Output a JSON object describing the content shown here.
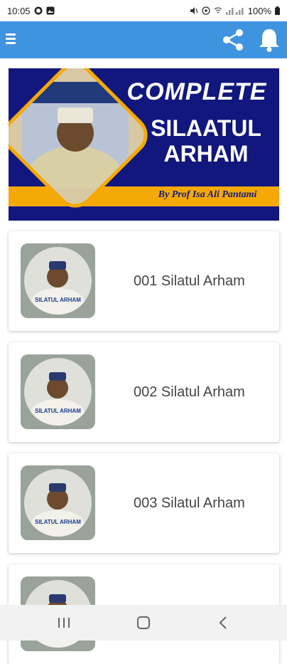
{
  "status_bar": {
    "time": "10:05",
    "battery": "100%"
  },
  "app_bar": {
    "menu_icon": "hamburger-menu-icon",
    "share_icon": "share-icon",
    "bell_icon": "bell-icon"
  },
  "banner": {
    "title_line1": "COMPLETE",
    "title_line2": "SILAATUL",
    "title_line3": "ARHAM",
    "byline": "By Prof Isa Ali Pantami"
  },
  "items": [
    {
      "title": "001 Silatul Arham",
      "thumb_label": "SILATUL ARHAM"
    },
    {
      "title": "002 Silatul Arham",
      "thumb_label": "SILATUL ARHAM"
    },
    {
      "title": "003 Silatul Arham",
      "thumb_label": "SILATUL ARHAM"
    },
    {
      "title": "",
      "thumb_label": ""
    }
  ],
  "colors": {
    "app_bar": "#3f94e0",
    "banner_bg": "#12177d",
    "banner_accent": "#f4a906"
  }
}
